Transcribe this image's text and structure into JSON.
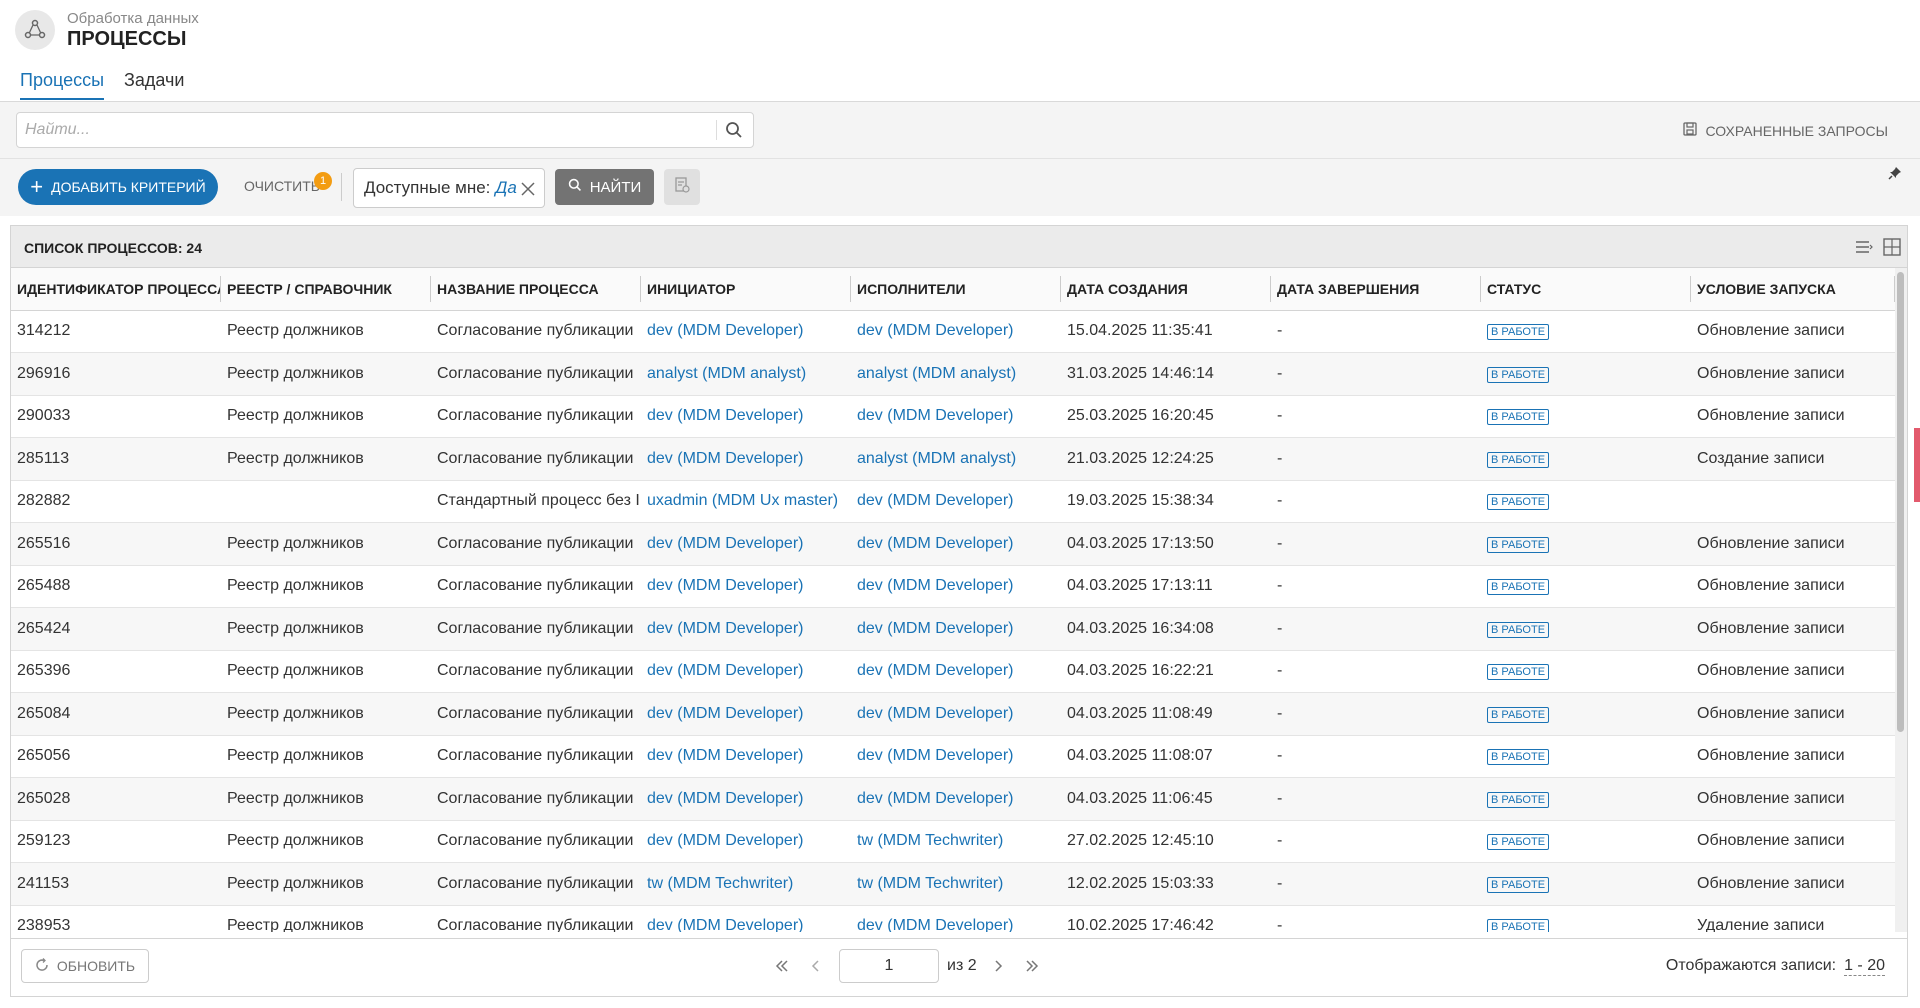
{
  "header": {
    "subtitle": "Обработка данных",
    "title": "ПРОЦЕССЫ"
  },
  "tabs": [
    {
      "label": "Процессы",
      "active": true
    },
    {
      "label": "Задачи",
      "active": false
    }
  ],
  "search": {
    "placeholder": "Найти..."
  },
  "saved_queries_label": "СОХРАНЕННЫЕ ЗАПРОСЫ",
  "toolbar": {
    "add_criteria_label": "ДОБАВИТЬ КРИТЕРИЙ",
    "clear_label": "ОЧИСТИТЬ",
    "clear_badge": "1",
    "filter_chip_label": "Доступные мне:",
    "filter_chip_value": "Да",
    "find_label": "НАЙТИ"
  },
  "panel": {
    "title": "СПИСОК ПРОЦЕССОВ: 24"
  },
  "table": {
    "columns": [
      "ИДЕНТИФИКАТОР ПРОЦЕССА",
      "РЕЕСТР / СПРАВОЧНИК",
      "НАЗВАНИЕ ПРОЦЕССА",
      "ИНИЦИАТОР",
      "ИСПОЛНИТЕЛИ",
      "ДАТА СОЗДАНИЯ",
      "ДАТА ЗАВЕРШЕНИЯ",
      "СТАТУС",
      "УСЛОВИЕ ЗАПУСКА"
    ],
    "rows": [
      [
        "314212",
        "Реестр должников",
        "Согласование публикации",
        "dev (MDM Developer)",
        "dev (MDM Developer)",
        "15.04.2025 11:35:41",
        "-",
        "В РАБОТЕ",
        "Обновление записи"
      ],
      [
        "296916",
        "Реестр должников",
        "Согласование публикации",
        "analyst (MDM analyst)",
        "analyst (MDM analyst)",
        "31.03.2025 14:46:14",
        "-",
        "В РАБОТЕ",
        "Обновление записи"
      ],
      [
        "290033",
        "Реестр должников",
        "Согласование публикации",
        "dev (MDM Developer)",
        "dev (MDM Developer)",
        "25.03.2025 16:20:45",
        "-",
        "В РАБОТЕ",
        "Обновление записи"
      ],
      [
        "285113",
        "Реестр должников",
        "Согласование публикации",
        "dev (MDM Developer)",
        "analyst (MDM analyst)",
        "21.03.2025 12:24:25",
        "-",
        "В РАБОТЕ",
        "Создание записи"
      ],
      [
        "282882",
        "",
        "Стандартный процесс без I",
        "uxadmin (MDM Ux master)",
        "dev (MDM Developer)",
        "19.03.2025 15:38:34",
        "-",
        "В РАБОТЕ",
        ""
      ],
      [
        "265516",
        "Реестр должников",
        "Согласование публикации",
        "dev (MDM Developer)",
        "dev (MDM Developer)",
        "04.03.2025 17:13:50",
        "-",
        "В РАБОТЕ",
        "Обновление записи"
      ],
      [
        "265488",
        "Реестр должников",
        "Согласование публикации",
        "dev (MDM Developer)",
        "dev (MDM Developer)",
        "04.03.2025 17:13:11",
        "-",
        "В РАБОТЕ",
        "Обновление записи"
      ],
      [
        "265424",
        "Реестр должников",
        "Согласование публикации",
        "dev (MDM Developer)",
        "dev (MDM Developer)",
        "04.03.2025 16:34:08",
        "-",
        "В РАБОТЕ",
        "Обновление записи"
      ],
      [
        "265396",
        "Реестр должников",
        "Согласование публикации",
        "dev (MDM Developer)",
        "dev (MDM Developer)",
        "04.03.2025 16:22:21",
        "-",
        "В РАБОТЕ",
        "Обновление записи"
      ],
      [
        "265084",
        "Реестр должников",
        "Согласование публикации",
        "dev (MDM Developer)",
        "dev (MDM Developer)",
        "04.03.2025 11:08:49",
        "-",
        "В РАБОТЕ",
        "Обновление записи"
      ],
      [
        "265056",
        "Реестр должников",
        "Согласование публикации",
        "dev (MDM Developer)",
        "dev (MDM Developer)",
        "04.03.2025 11:08:07",
        "-",
        "В РАБОТЕ",
        "Обновление записи"
      ],
      [
        "265028",
        "Реестр должников",
        "Согласование публикации",
        "dev (MDM Developer)",
        "dev (MDM Developer)",
        "04.03.2025 11:06:45",
        "-",
        "В РАБОТЕ",
        "Обновление записи"
      ],
      [
        "259123",
        "Реестр должников",
        "Согласование публикации",
        "dev (MDM Developer)",
        "tw (MDM Techwriter)",
        "27.02.2025 12:45:10",
        "-",
        "В РАБОТЕ",
        "Обновление записи"
      ],
      [
        "241153",
        "Реестр должников",
        "Согласование публикации",
        "tw (MDM Techwriter)",
        "tw (MDM Techwriter)",
        "12.02.2025 15:03:33",
        "-",
        "В РАБОТЕ",
        "Обновление записи"
      ],
      [
        "238953",
        "Реестр должников",
        "Согласование публикации",
        "dev (MDM Developer)",
        "dev (MDM Developer)",
        "10.02.2025 17:46:42",
        "-",
        "В РАБОТЕ",
        "Удаление записи"
      ]
    ]
  },
  "footer": {
    "refresh_label": "ОБНОВИТЬ",
    "page_value": "1",
    "page_of": "из 2",
    "records_label": "Отображаются записи:",
    "records_range": "1 - 20"
  },
  "colors": {
    "accent": "#1a73b5",
    "badge": "#f39c12",
    "find_button": "#737373"
  }
}
